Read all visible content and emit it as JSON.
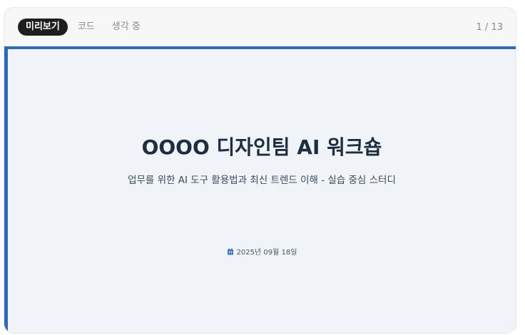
{
  "tabs": [
    {
      "label": "미리보기",
      "active": true
    },
    {
      "label": "코드",
      "active": false
    },
    {
      "label": "생각 중",
      "active": false
    }
  ],
  "page_counter": "1 / 13",
  "slide": {
    "title": "OOOO 디자인팀 AI 워크숍",
    "subtitle": "업무를 위한 AI 도구 활용법과 최신 트렌드 이해 - 실습 중심 스터디",
    "date": "2025년 09월 18일",
    "date_icon": "calendar-icon"
  },
  "colors": {
    "accent": "#2f6bb0",
    "slide_background": "#f0f3f7",
    "title": "#1f2d40",
    "active_tab_background": "#1e1e1e"
  }
}
